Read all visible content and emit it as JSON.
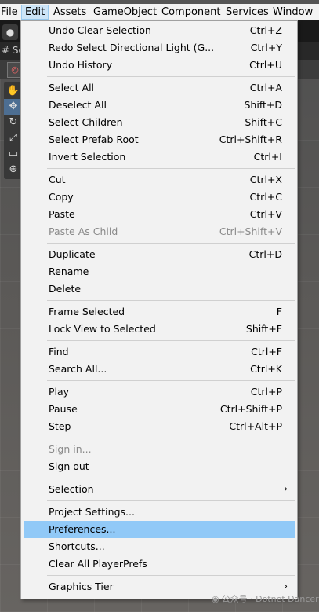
{
  "menubar": {
    "items": [
      {
        "label": "File"
      },
      {
        "label": "Edit"
      },
      {
        "label": "Assets"
      },
      {
        "label": "GameObject"
      },
      {
        "label": "Component"
      },
      {
        "label": "Services"
      },
      {
        "label": "Window"
      }
    ]
  },
  "scene": {
    "tab_label": "# Sc"
  },
  "edit_menu": {
    "items": [
      {
        "label": "Undo Clear Selection",
        "shortcut": "Ctrl+Z"
      },
      {
        "label": "Redo Select Directional Light (G...",
        "shortcut": "Ctrl+Y"
      },
      {
        "label": "Undo History",
        "shortcut": "Ctrl+U"
      },
      {
        "label": "Select All",
        "shortcut": "Ctrl+A"
      },
      {
        "label": "Deselect All",
        "shortcut": "Shift+D"
      },
      {
        "label": "Select Children",
        "shortcut": "Shift+C"
      },
      {
        "label": "Select Prefab Root",
        "shortcut": "Ctrl+Shift+R"
      },
      {
        "label": "Invert Selection",
        "shortcut": "Ctrl+I"
      },
      {
        "label": "Cut",
        "shortcut": "Ctrl+X"
      },
      {
        "label": "Copy",
        "shortcut": "Ctrl+C"
      },
      {
        "label": "Paste",
        "shortcut": "Ctrl+V"
      },
      {
        "label": "Paste As Child",
        "shortcut": "Ctrl+Shift+V",
        "disabled": true
      },
      {
        "label": "Duplicate",
        "shortcut": "Ctrl+D"
      },
      {
        "label": "Rename",
        "shortcut": ""
      },
      {
        "label": "Delete",
        "shortcut": ""
      },
      {
        "label": "Frame Selected",
        "shortcut": "F"
      },
      {
        "label": "Lock View to Selected",
        "shortcut": "Shift+F"
      },
      {
        "label": "Find",
        "shortcut": "Ctrl+F"
      },
      {
        "label": "Search All...",
        "shortcut": "Ctrl+K"
      },
      {
        "label": "Play",
        "shortcut": "Ctrl+P"
      },
      {
        "label": "Pause",
        "shortcut": "Ctrl+Shift+P"
      },
      {
        "label": "Step",
        "shortcut": "Ctrl+Alt+P"
      },
      {
        "label": "Sign in...",
        "shortcut": "",
        "disabled": true
      },
      {
        "label": "Sign out",
        "shortcut": ""
      },
      {
        "label": "Selection",
        "shortcut": "",
        "submenu": true
      },
      {
        "label": "Project Settings...",
        "shortcut": ""
      },
      {
        "label": "Preferences...",
        "shortcut": "",
        "highlighted": true
      },
      {
        "label": "Shortcuts...",
        "shortcut": ""
      },
      {
        "label": "Clear All PlayerPrefs",
        "shortcut": ""
      },
      {
        "label": "Graphics Tier",
        "shortcut": "",
        "submenu": true
      }
    ],
    "submenu_glyph": "›"
  },
  "watermark": {
    "text": "公众号 · Dotnet Dancer"
  },
  "colors": {
    "highlight": "#91c9f7",
    "menu_bg": "#f2f2f2",
    "menubar_active": "#cce4f7"
  }
}
